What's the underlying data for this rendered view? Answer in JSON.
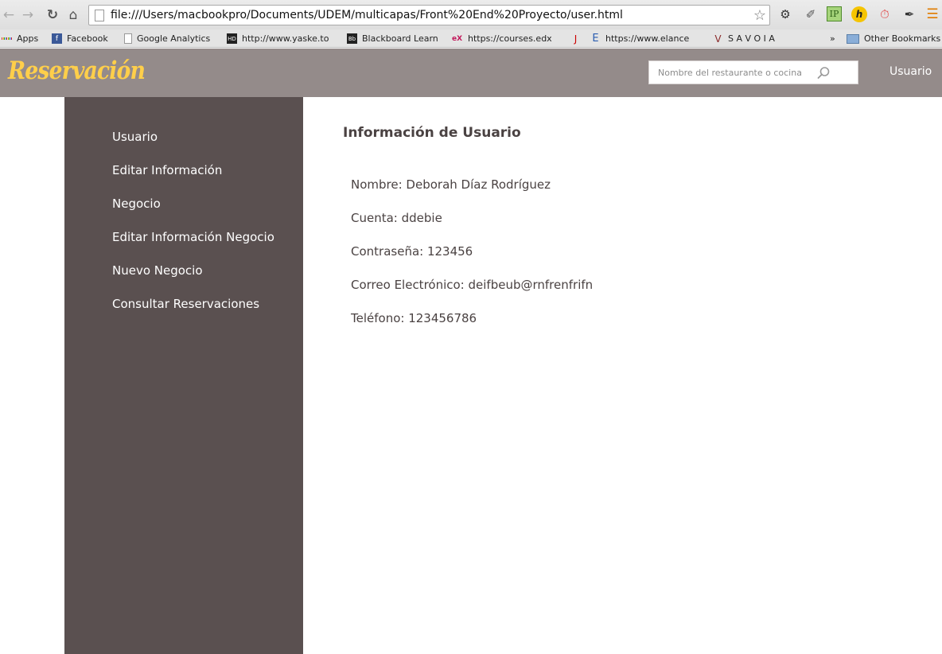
{
  "browser": {
    "url": "file:///Users/macbookpro/Documents/UDEM/multicapas/Front%20End%20Proyecto/user.html",
    "bookmarks": [
      {
        "label": "Apps",
        "icon": "apps-grid-icon"
      },
      {
        "label": "Facebook",
        "icon": "facebook-icon"
      },
      {
        "label": "Google Analytics",
        "icon": "page-icon"
      },
      {
        "label": "http://www.yaske.to",
        "icon": "hd-icon"
      },
      {
        "label": "Blackboard Learn",
        "icon": "bb-icon"
      },
      {
        "label": "https://courses.edx",
        "icon": "edx-icon"
      },
      {
        "label": "https://www.elance",
        "icon": "elance-icon"
      },
      {
        "label": "S A V O I A",
        "icon": "savoia-icon"
      },
      {
        "label": "»",
        "icon": "chevron-icon"
      },
      {
        "label": "Other Bookmarks",
        "icon": "folder-icon"
      }
    ]
  },
  "header": {
    "logo": "Reservación",
    "search_placeholder": "Nombre del restaurante o cocina",
    "user_link": "Usuario"
  },
  "sidebar": {
    "items": [
      {
        "label": "Usuario"
      },
      {
        "label": "Editar Información"
      },
      {
        "label": "Negocio"
      },
      {
        "label": "Editar Información Negocio"
      },
      {
        "label": "Nuevo Negocio"
      },
      {
        "label": "Consultar Reservaciones"
      }
    ]
  },
  "main": {
    "title": "Información de Usuario",
    "fields": [
      {
        "text": "Nombre: Deborah Díaz Rodríguez"
      },
      {
        "text": "Cuenta: ddebie"
      },
      {
        "text": "Contraseña: 123456"
      },
      {
        "text": "Correo Electrónico: deifbeub@rnfrenfrifn"
      },
      {
        "text": "Teléfono: 123456786"
      }
    ]
  },
  "colors": {
    "header_bg": "#948b8a",
    "sidebar_bg": "#5a5050",
    "logo": "#ffcf4a",
    "text": "#4a4242"
  }
}
